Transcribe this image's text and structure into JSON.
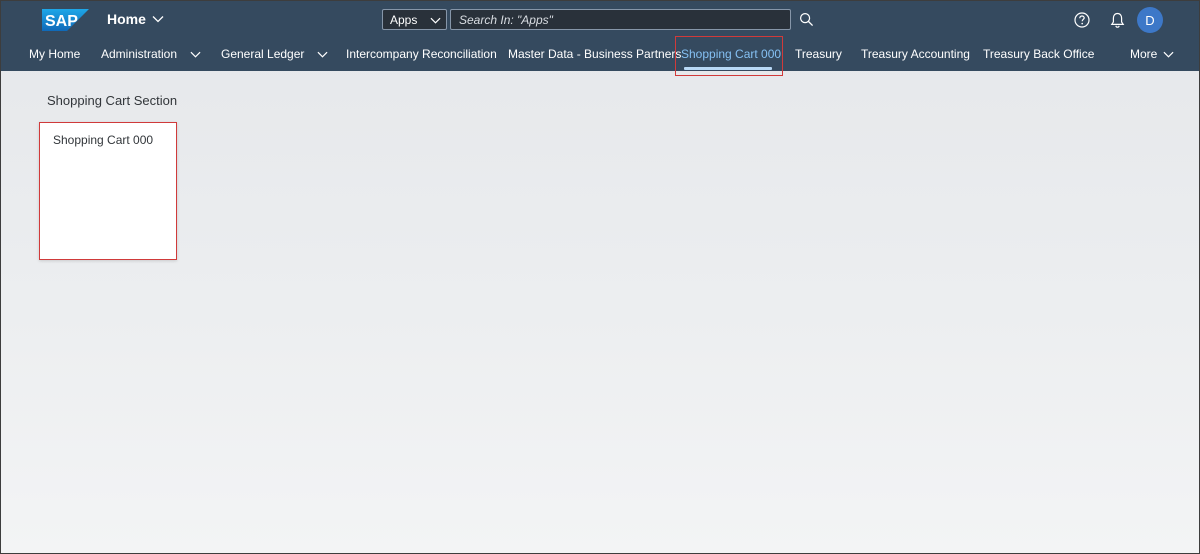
{
  "shell": {
    "logo_text": "SAP",
    "home_label": "Home",
    "scope": "Apps",
    "search_placeholder": "Search In: \"Apps\"",
    "avatar_initial": "D"
  },
  "nav": {
    "items": [
      {
        "label": "My Home"
      },
      {
        "label": "Administration"
      },
      {
        "label": "General Ledger"
      },
      {
        "label": "Intercompany Reconciliation"
      },
      {
        "label": "Master Data - Business Partners"
      },
      {
        "label": "Shopping Cart 000"
      },
      {
        "label": "Treasury"
      },
      {
        "label": "Treasury Accounting"
      },
      {
        "label": "Treasury Back Office"
      },
      {
        "label": "More"
      }
    ],
    "active_index": 5
  },
  "content": {
    "section_title": "Shopping Cart Section",
    "tiles": [
      {
        "title": "Shopping Cart 000"
      }
    ]
  },
  "colors": {
    "shell_bg": "#354a5f",
    "active_tab": "#85c0f3",
    "avatar_bg": "#3d78c8",
    "highlight": "#d03a3a"
  }
}
